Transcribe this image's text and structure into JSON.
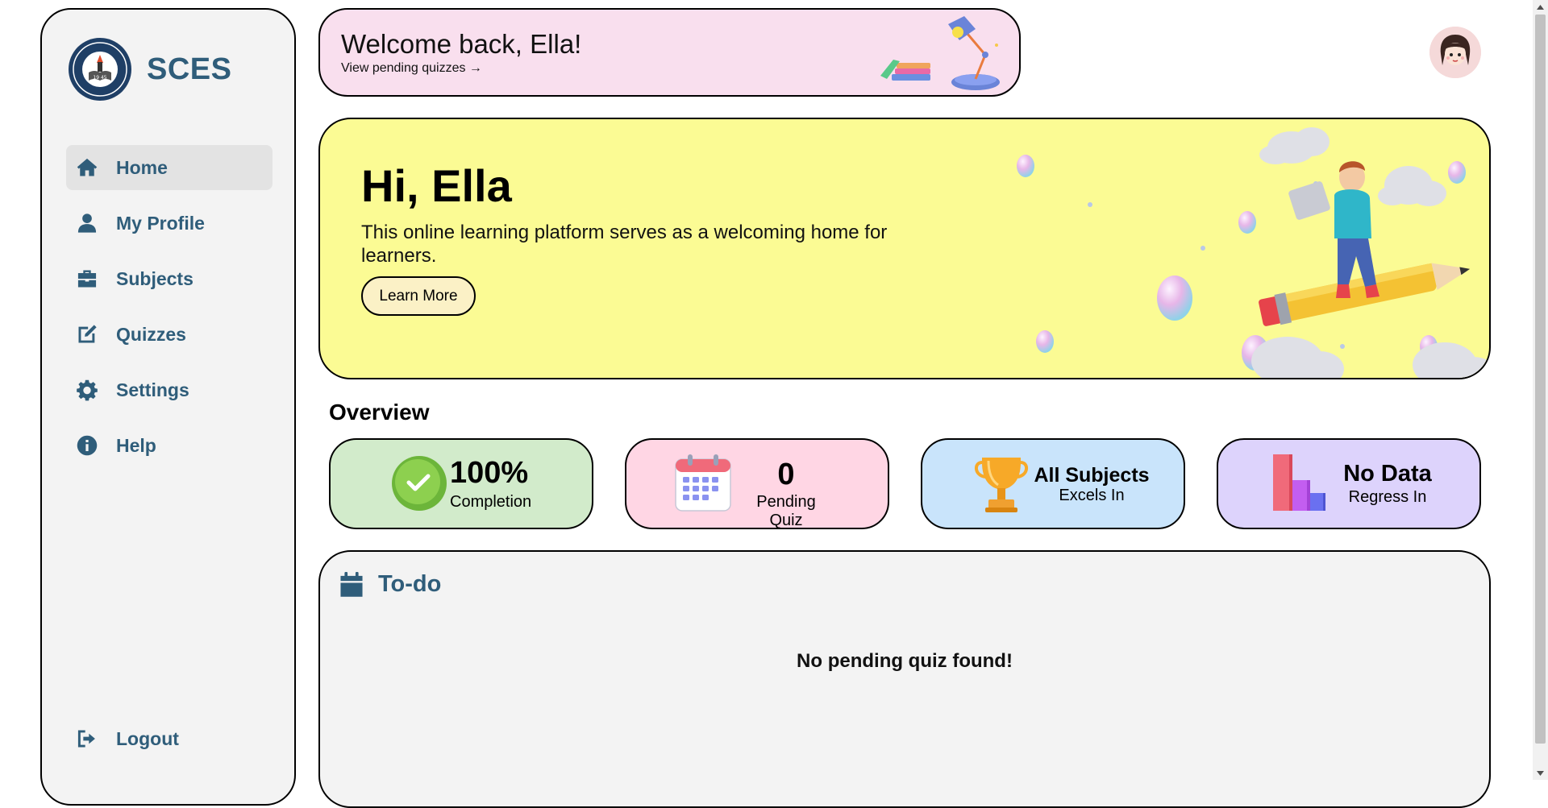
{
  "brand": {
    "name": "SCES",
    "logo_text": "STA. CLARA ELEMENTARY SCHOOL",
    "logo_sub": "BATANGAS CITY",
    "logo_year": "1945"
  },
  "sidebar": {
    "items": [
      {
        "label": "Home",
        "icon": "home-icon",
        "active": true
      },
      {
        "label": "My Profile",
        "icon": "user-icon",
        "active": false
      },
      {
        "label": "Subjects",
        "icon": "briefcase-icon",
        "active": false
      },
      {
        "label": "Quizzes",
        "icon": "edit-icon",
        "active": false
      },
      {
        "label": "Settings",
        "icon": "gear-icon",
        "active": false
      },
      {
        "label": "Help",
        "icon": "info-icon",
        "active": false
      }
    ],
    "logout_label": "Logout"
  },
  "welcome": {
    "title": "Welcome back, Ella!",
    "link": "View pending quizzes →"
  },
  "hero": {
    "title": "Hi, Ella",
    "text": "This online learning platform serves as a welcoming home for learners.",
    "button": "Learn More"
  },
  "overview": {
    "title": "Overview",
    "cards": [
      {
        "value": "100%",
        "label": "Completion",
        "icon": "check-icon"
      },
      {
        "value": "0",
        "label": "Pending Quiz",
        "icon": "calendar-icon"
      },
      {
        "value": "All Subjects",
        "label": "Excels In",
        "icon": "trophy-icon"
      },
      {
        "value": "No Data",
        "label": "Regress In",
        "icon": "bar-chart-icon"
      }
    ]
  },
  "todo": {
    "title": "To-do",
    "empty": "No pending quiz found!"
  },
  "colors": {
    "accent": "#2f5d7a",
    "welcome_bg": "#f9dfee",
    "hero_bg": "#fbfb94",
    "card_completion": "#d2ebcb",
    "card_pending": "#ffd6e4",
    "card_excels": "#c9e4fb",
    "card_regress": "#ddd3fc"
  }
}
